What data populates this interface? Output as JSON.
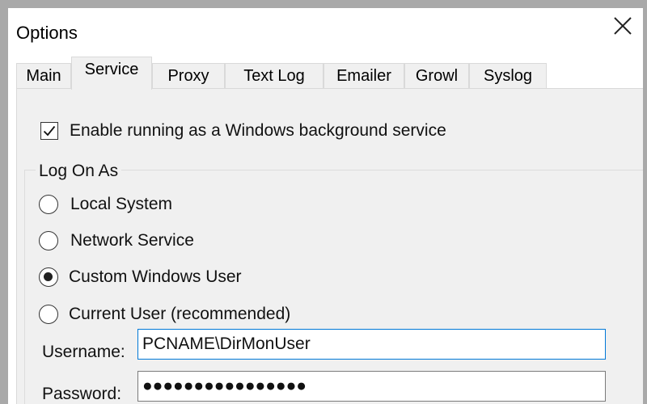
{
  "window": {
    "title": "Options",
    "close_glyph": "close-icon"
  },
  "tabs": [
    {
      "label": "Main",
      "active": false
    },
    {
      "label": "Service",
      "active": true
    },
    {
      "label": "Proxy",
      "active": false
    },
    {
      "label": "Text Log",
      "active": false
    },
    {
      "label": "Emailer",
      "active": false
    },
    {
      "label": "Growl",
      "active": false
    },
    {
      "label": "Syslog",
      "active": false
    }
  ],
  "service": {
    "enable_label": "Enable running as a Windows background service",
    "enable_checked": true,
    "group_title": "Log On As",
    "options": [
      {
        "label": "Local System",
        "checked": false
      },
      {
        "label": "Network Service",
        "checked": false
      },
      {
        "label": "Custom Windows User",
        "checked": true
      },
      {
        "label": "Current User (recommended)",
        "checked": false
      }
    ],
    "username_label": "Username:",
    "username_value": "PCNAME\\DirMonUser",
    "password_label": "Password:",
    "password_value": "●●●●●●●●●●●●●●●●"
  },
  "colors": {
    "focus_border": "#0078d7",
    "panel_bg": "#f0f0f0"
  }
}
